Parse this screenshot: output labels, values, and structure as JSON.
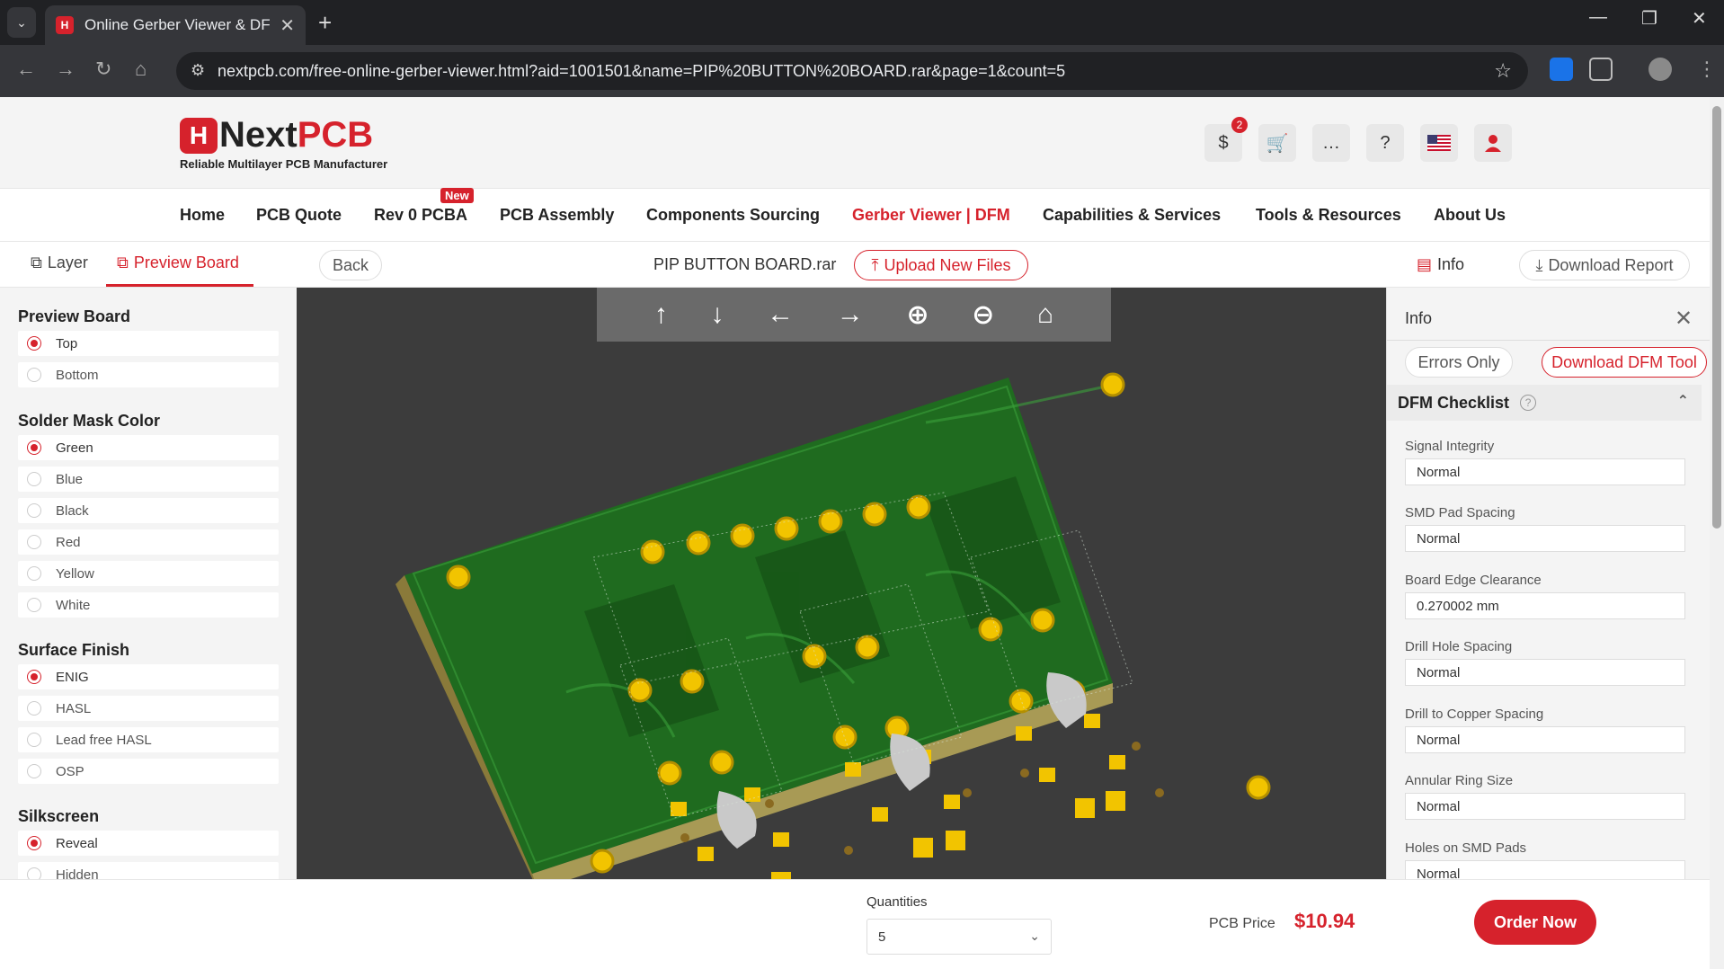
{
  "browser": {
    "tab_title": "Online Gerber Viewer & DFM A",
    "url": "nextpcb.com/free-online-gerber-viewer.html?aid=1001501&name=PIP%20BUTTON%20BOARD.rar&page=1&count=5"
  },
  "header": {
    "logo_mark": "H",
    "logo_name_a": "Next",
    "logo_name_b": "PCB",
    "logo_tagline": "Reliable Multilayer PCB Manufacturer",
    "wallet_badge": "2",
    "icons": [
      "dollar-icon",
      "cart-icon",
      "chat-icon",
      "help-icon",
      "us-flag-icon",
      "user-icon"
    ]
  },
  "menu": {
    "items": [
      "Home",
      "PCB Quote",
      "Rev 0 PCBA",
      "PCB Assembly",
      "Components Sourcing",
      "Gerber Viewer | DFM",
      "Capabilities & Services",
      "Tools & Resources",
      "About Us"
    ],
    "active": "Gerber Viewer | DFM",
    "new_badge": "New"
  },
  "toolbar": {
    "layer_tab": "Layer",
    "preview_tab": "Preview Board",
    "back": "Back",
    "file_name": "PIP BUTTON BOARD.rar",
    "upload": "Upload New Files",
    "info": "Info",
    "download_report": "Download Report"
  },
  "sidebar": {
    "preview_board": {
      "title": "Preview Board",
      "options": [
        "Top",
        "Bottom"
      ],
      "selected": "Top"
    },
    "solder_mask": {
      "title": "Solder Mask Color",
      "options": [
        "Green",
        "Blue",
        "Black",
        "Red",
        "Yellow",
        "White"
      ],
      "selected": "Green"
    },
    "surface_finish": {
      "title": "Surface Finish",
      "options": [
        "ENIG",
        "HASL",
        "Lead free HASL",
        "OSP"
      ],
      "selected": "ENIG"
    },
    "silkscreen": {
      "title": "Silkscreen",
      "options": [
        "Reveal",
        "Hidden"
      ],
      "selected": "Reveal"
    }
  },
  "viewer_tools": [
    "arrow-up-icon",
    "arrow-down-icon",
    "arrow-left-icon",
    "arrow-right-icon",
    "zoom-in-icon",
    "zoom-out-icon",
    "home-icon"
  ],
  "info_panel": {
    "title": "Info",
    "errors_only": "Errors Only",
    "download_dfm": "Download DFM Tool",
    "checklist_title": "DFM Checklist",
    "checks": [
      {
        "label": "Signal Integrity",
        "value": "Normal"
      },
      {
        "label": "SMD Pad Spacing",
        "value": "Normal"
      },
      {
        "label": "Board Edge Clearance",
        "value": "0.270002 mm"
      },
      {
        "label": "Drill Hole Spacing",
        "value": "Normal"
      },
      {
        "label": "Drill to Copper Spacing",
        "value": "Normal"
      },
      {
        "label": "Annular Ring Size",
        "value": "Normal"
      },
      {
        "label": "Holes on SMD Pads",
        "value": "Normal"
      }
    ]
  },
  "footer": {
    "quantities_label": "Quantities",
    "quantity": "5",
    "price_label": "PCB Price",
    "price": "$10.94",
    "order": "Order Now"
  },
  "colors": {
    "accent": "#d6222c",
    "board_green": "#1f6b1f",
    "pad_gold": "#f2c400"
  }
}
